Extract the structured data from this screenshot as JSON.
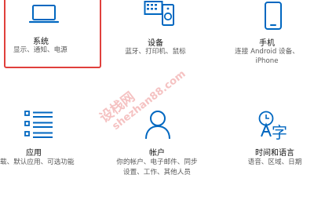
{
  "colors": {
    "accent": "#0067c0",
    "selection_border": "#e0403c",
    "watermark": "#e87878"
  },
  "tiles": [
    {
      "id": "system",
      "icon": "laptop-icon",
      "title": "系统",
      "desc": [
        "显示、通知、电源"
      ],
      "selected": true
    },
    {
      "id": "devices",
      "icon": "devices-icon",
      "title": "设备",
      "desc": [
        "蓝牙、打印机、鼠标"
      ]
    },
    {
      "id": "phone",
      "icon": "phone-icon",
      "title": "手机",
      "desc": [
        "连接 Android 设备、",
        "iPhone"
      ]
    },
    {
      "id": "apps",
      "icon": "apps-list-icon",
      "title": "应用",
      "desc": [
        "卸载、默认应用、可选功能"
      ]
    },
    {
      "id": "accounts",
      "icon": "person-icon",
      "title": "帐户",
      "desc": [
        "你的帐户、电子邮件、同步",
        "设置、工作、其他人员"
      ]
    },
    {
      "id": "time",
      "icon": "time-language-icon",
      "title": "时间和语言",
      "desc": [
        "语音、区域、日期"
      ]
    }
  ],
  "watermark": {
    "line1": "设栈网",
    "line2": "shezhan88.com"
  }
}
